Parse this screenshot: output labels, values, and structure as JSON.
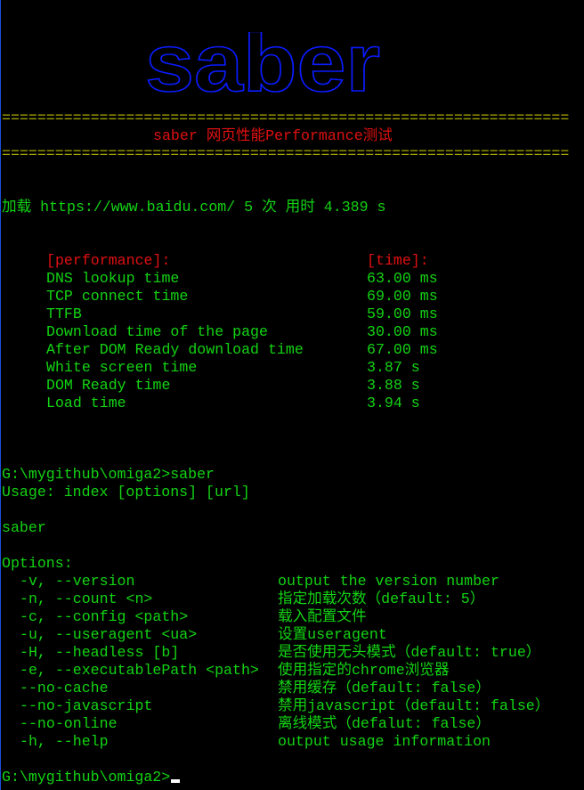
{
  "logo": "saber",
  "separator": "================================================================",
  "title": "saber 网页性能Performance测试",
  "load_line": "加载 https://www.baidu.com/ 5 次 用时 4.389 s",
  "perf": {
    "header_label": "[performance]:",
    "header_time": "[time]:",
    "rows": [
      {
        "label": "DNS lookup time",
        "value": "63.00 ms"
      },
      {
        "label": "TCP connect time",
        "value": "69.00 ms"
      },
      {
        "label": "TTFB",
        "value": "59.00 ms"
      },
      {
        "label": "Download time of the page",
        "value": "30.00 ms"
      },
      {
        "label": "After DOM Ready download time",
        "value": "67.00 ms"
      },
      {
        "label": "White screen time",
        "value": "3.87 s"
      },
      {
        "label": "DOM Ready time",
        "value": "3.88 s"
      },
      {
        "label": "Load time",
        "value": "3.94 s"
      }
    ]
  },
  "command": "G:\\mygithub\\omiga2>saber",
  "usage": "Usage: index [options] [url]",
  "program": "saber",
  "options_title": "Options:",
  "options": [
    {
      "flag": "-v, --version",
      "desc": "output the version number"
    },
    {
      "flag": "-n, --count <n>",
      "desc": "指定加载次数（default: 5）"
    },
    {
      "flag": "-c, --config <path>",
      "desc": "载入配置文件"
    },
    {
      "flag": "-u, --useragent <ua>",
      "desc": "设置useragent"
    },
    {
      "flag": "-H, --headless [b]",
      "desc": "是否使用无头模式（default: true）"
    },
    {
      "flag": "-e, --executablePath <path>",
      "desc": "使用指定的chrome浏览器"
    },
    {
      "flag": "--no-cache",
      "desc": "禁用缓存（default: false）"
    },
    {
      "flag": "--no-javascript",
      "desc": "禁用javascript（default: false）"
    },
    {
      "flag": "--no-online",
      "desc": "离线模式（defalut: false）"
    },
    {
      "flag": "-h, --help",
      "desc": "output usage information"
    }
  ],
  "prompt": "G:\\mygithub\\omiga2>"
}
